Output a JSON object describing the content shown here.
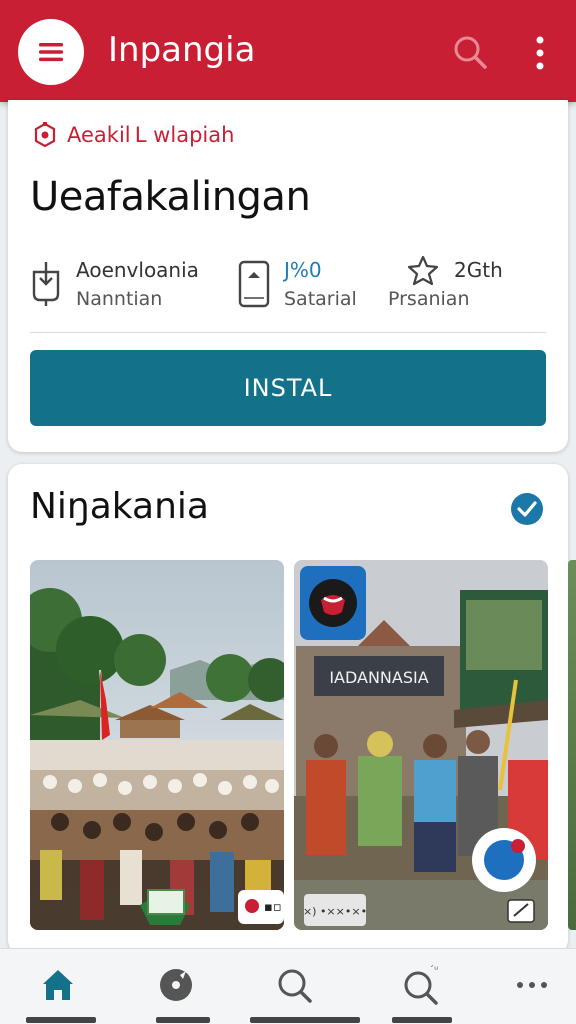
{
  "app_bar": {
    "title": "Inpangia",
    "menu_icon": "hamburger-menu-icon",
    "search_icon": "search-icon",
    "more_icon": "more-vertical-icon",
    "color": "#c81f35"
  },
  "app_card": {
    "developer": "Aeakil L wlapiah",
    "app_name": "Ueafakalingan",
    "stats": [
      {
        "icon": "download-icon",
        "value": "Aoenvloania",
        "label": "Nanntian"
      },
      {
        "icon": "phone-icon",
        "value": "J%0",
        "label": "Satarial"
      },
      {
        "icon": "star-icon",
        "value": "2Gth",
        "label": "Prsanian"
      }
    ],
    "install_label": "INSTAL",
    "install_color": "#137189"
  },
  "gallery": {
    "title": "Niŋakania",
    "verified_icon": "verified-check-icon",
    "screenshots": [
      {
        "caption": ""
      },
      {
        "sign_text": "IADANNASIA",
        "board_text": "×) •××•×•"
      }
    ]
  },
  "bottom_nav": {
    "items": [
      {
        "icon": "home-icon",
        "active": true
      },
      {
        "icon": "discover-icon",
        "active": false
      },
      {
        "icon": "search-icon",
        "active": false
      },
      {
        "icon": "search-badge-icon",
        "active": false,
        "badge": " ´ᵘ"
      },
      {
        "icon": "more-horizontal-icon",
        "active": false
      }
    ]
  }
}
